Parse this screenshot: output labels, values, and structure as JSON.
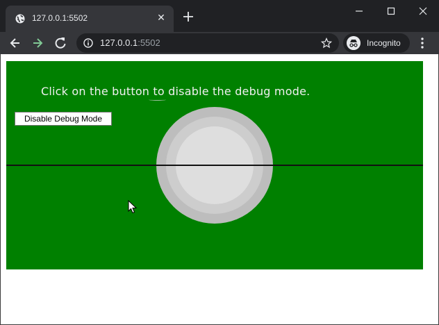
{
  "browser": {
    "tab_title": "127.0.0.1:5502",
    "tab_close": "✕",
    "url_host": "127.0.0.1",
    "url_port": ":5502",
    "incognito_label": "Incognito"
  },
  "page": {
    "instruction": "Click on the button to disable the debug mode.",
    "button_label": "Disable Debug Mode"
  },
  "colors": {
    "canvas_background": "#008000",
    "circle_outer": "#bdbdbd",
    "circle_inner": "#dedede",
    "line": "#111111"
  },
  "icons": [
    "globe-icon",
    "close-icon",
    "plus-icon",
    "minimize-icon",
    "maximize-icon",
    "window-close-icon",
    "back-arrow-icon",
    "forward-arrow-icon",
    "reload-icon",
    "info-icon",
    "star-icon",
    "incognito-icon",
    "kebab-menu-icon",
    "mouse-cursor-icon"
  ]
}
